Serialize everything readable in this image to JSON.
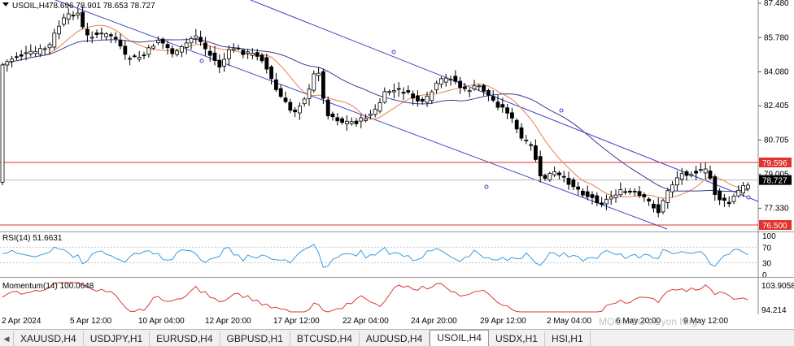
{
  "main": {
    "symbol_label": "USOIL,H4",
    "ohlc": "78.696 78.901 78.653 78.727",
    "price_ticks": [
      "87.480",
      "85.780",
      "84.080",
      "82.405",
      "80.705",
      "79.005",
      "77.330"
    ],
    "levels": [
      {
        "label": "79.596",
        "value": 79.596,
        "color": "#e0332d"
      },
      {
        "label": "76.500",
        "value": 76.5,
        "color": "#e0332d"
      }
    ],
    "current_price": {
      "label": "78.727",
      "value": 78.727
    },
    "colors": {
      "channel": "#4040c8",
      "ma_fast": "#e8824a",
      "ma_slow": "#3c3c8c",
      "up_candle": "#ffffff",
      "down_candle": "#000000"
    }
  },
  "rsi": {
    "label": "RSI(14) 51.6631",
    "ticks": [
      "100",
      "70",
      "30",
      "0"
    ],
    "color": "#3c9be0"
  },
  "momentum": {
    "label": "Momentum(14) 100.0648",
    "ticks": [
      "103.9058",
      "94.214"
    ],
    "color": "#d83a32"
  },
  "time_axis": [
    "2 Apr 2024",
    "5 Apr 12:00",
    "10 Apr 04:00",
    "12 Apr 20:00",
    "17 Apr 12:00",
    "22 Apr 04:00",
    "24 Apr 20:00",
    "29 Apr 12:00",
    "2 May 04:00",
    "6 May 20:00",
    "9 May 12:00"
  ],
  "watermark": "MOOMOO ÞEyon Nirg",
  "tabs": [
    "XAUUSD,H4",
    "USDJPY,H1",
    "EURUSD,H4",
    "GBPUSD,H1",
    "BTCUSD,H4",
    "AUDUSD,H4",
    "USOIL,H4",
    "USDX,H1",
    "HSI,H1"
  ],
  "active_tab": "USOIL,H4",
  "icons": {
    "tab_scroll_left": "triangle-left-icon",
    "symbol_menu": "triangle-down-icon"
  }
}
